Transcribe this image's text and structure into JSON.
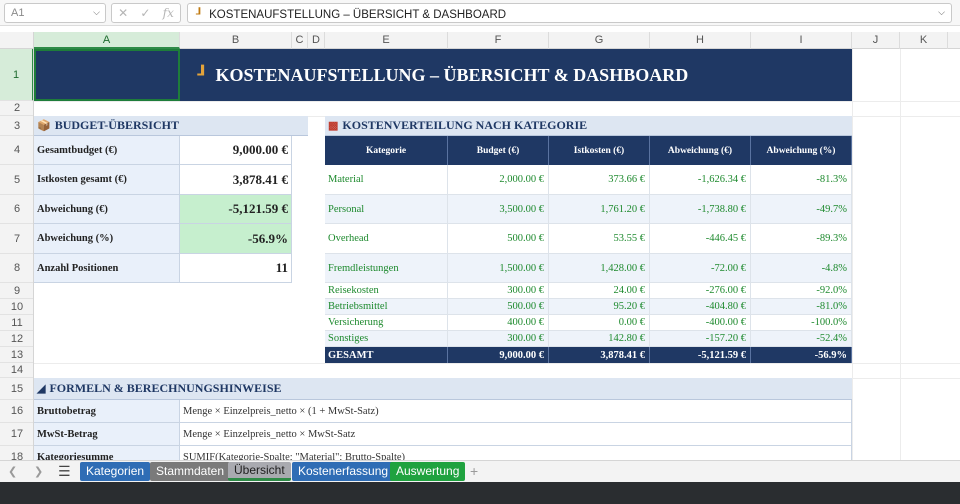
{
  "formula_bar": {
    "cell_ref": "A1",
    "formula": "KOSTENAUFSTELLUNG – ÜBERSICHT & DASHBOARD"
  },
  "columns": [
    "A",
    "B",
    "C",
    "D",
    "E",
    "F",
    "G",
    "H",
    "I",
    "J",
    "K"
  ],
  "rows": [
    "1",
    "2",
    "3",
    "4",
    "5",
    "6",
    "7",
    "8",
    "9",
    "10",
    "11",
    "12",
    "13",
    "14",
    "15",
    "16",
    "17",
    "18"
  ],
  "title": "KOSTENAUFSTELLUNG – ÜBERSICHT & DASHBOARD",
  "budget": {
    "header": "BUDGET-ÜBERSICHT",
    "items": [
      {
        "label": "Gesamtbudget (€)",
        "value": "9,000.00 €"
      },
      {
        "label": "Istkosten gesamt (€)",
        "value": "3,878.41 €"
      },
      {
        "label": "Abweichung (€)",
        "value": "-5,121.59 €"
      },
      {
        "label": "Abweichung (%)",
        "value": "-56.9%"
      },
      {
        "label": "Anzahl Positionen",
        "value": "11"
      }
    ]
  },
  "distribution": {
    "header": "KOSTENVERTEILUNG NACH KATEGORIE",
    "columns": [
      "Kategorie",
      "Budget (€)",
      "Istkosten (€)",
      "Abweichung (€)",
      "Abweichung (%)"
    ],
    "rows": [
      {
        "kategorie": "Material",
        "budget": "2,000.00 €",
        "ist": "373.66 €",
        "abw": "-1,626.34 €",
        "pct": "-81.3%"
      },
      {
        "kategorie": "Personal",
        "budget": "3,500.00 €",
        "ist": "1,761.20 €",
        "abw": "-1,738.80 €",
        "pct": "-49.7%"
      },
      {
        "kategorie": "Overhead",
        "budget": "500.00 €",
        "ist": "53.55 €",
        "abw": "-446.45 €",
        "pct": "-89.3%"
      },
      {
        "kategorie": "Fremdleistungen",
        "budget": "1,500.00 €",
        "ist": "1,428.00 €",
        "abw": "-72.00 €",
        "pct": "-4.8%"
      },
      {
        "kategorie": "Reisekosten",
        "budget": "300.00 €",
        "ist": "24.00 €",
        "abw": "-276.00 €",
        "pct": "-92.0%"
      },
      {
        "kategorie": "Betriebsmittel",
        "budget": "500.00 €",
        "ist": "95.20 €",
        "abw": "-404.80 €",
        "pct": "-81.0%"
      },
      {
        "kategorie": "Versicherung",
        "budget": "400.00 €",
        "ist": "0.00 €",
        "abw": "-400.00 €",
        "pct": "-100.0%"
      },
      {
        "kategorie": "Sonstiges",
        "budget": "300.00 €",
        "ist": "142.80 €",
        "abw": "-157.20 €",
        "pct": "-52.4%"
      }
    ],
    "total": {
      "kategorie": "GESAMT",
      "budget": "9,000.00 €",
      "ist": "3,878.41 €",
      "abw": "-5,121.59 €",
      "pct": "-56.9%"
    }
  },
  "formulas": {
    "header": "FORMELN & BERECHNUNGSHINWEISE",
    "items": [
      {
        "label": "Bruttobetrag",
        "text": "Menge × Einzelpreis_netto × (1 + MwSt-Satz)"
      },
      {
        "label": "MwSt-Betrag",
        "text": "Menge × Einzelpreis_netto × MwSt-Satz"
      },
      {
        "label": "Kategoriesumme",
        "text": "SUMIF(Kategorie-Spalte; \"Material\"; Brutto-Spalte)"
      }
    ]
  },
  "sheet_tabs": [
    {
      "label": "Kategorien",
      "color": "#2f6db5"
    },
    {
      "label": "Stammdaten",
      "color": "#7a7a7a"
    },
    {
      "label": "Übersicht",
      "color": "#a9aab0"
    },
    {
      "label": "Kostenerfassung",
      "color": "#2f6db5"
    },
    {
      "label": "Auswertung",
      "color": "#1fa23f"
    }
  ],
  "colors": {
    "header_navy": "#1f3864",
    "section_bg": "#dde6f2",
    "positive_green": "#1e8a2e",
    "highlight_green": "#c6efce"
  }
}
